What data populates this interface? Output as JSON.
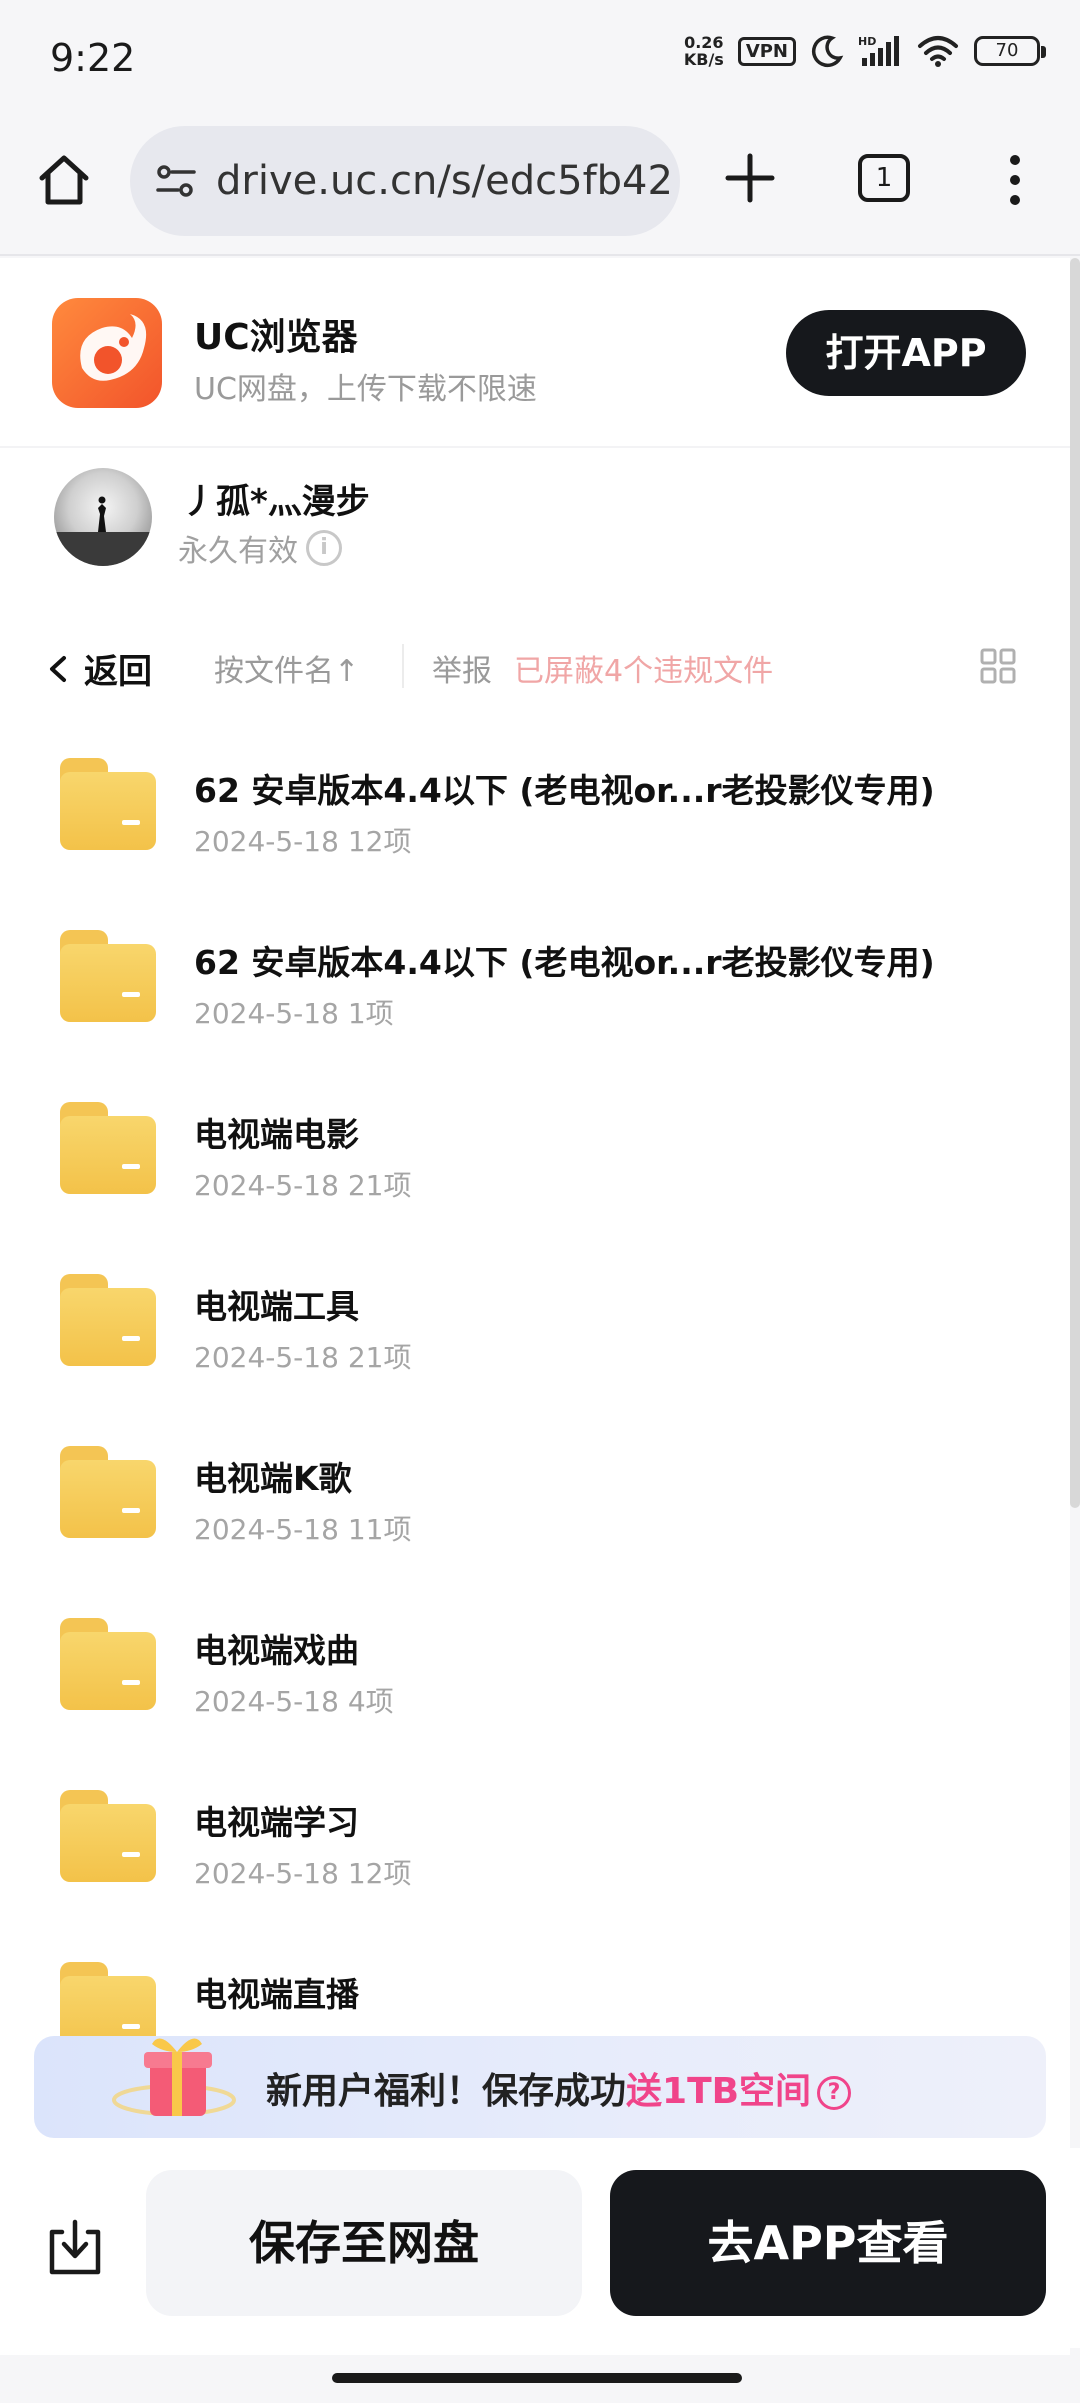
{
  "status_bar": {
    "time": "9:22",
    "net_speed_value": "0.26",
    "net_speed_unit": "KB/s",
    "vpn": "VPN",
    "battery": "70"
  },
  "browser": {
    "url": "drive.uc.cn/s/edc5fb42",
    "tab_count": "1"
  },
  "app_banner": {
    "name": "UC浏览器",
    "slogan": "UC网盘，上传下载不限速",
    "open_button": "打开APP"
  },
  "share": {
    "owner": "丿孤*灬漫步",
    "validity": "永久有效"
  },
  "toolbar": {
    "back": "返回",
    "sort": "按文件名",
    "sort_arrow": "↑",
    "report": "举报",
    "blocked": "已屏蔽4个违规文件"
  },
  "files": [
    {
      "title": "62 安卓版本4.4以下 (老电视or...r老投影仪专用)",
      "date": "2024-5-18",
      "count": "12项"
    },
    {
      "title": "62 安卓版本4.4以下 (老电视or...r老投影仪专用)",
      "date": "2024-5-18",
      "count": "1项"
    },
    {
      "title": "电视端电影",
      "date": "2024-5-18",
      "count": "21项"
    },
    {
      "title": "电视端工具",
      "date": "2024-5-18",
      "count": "21项"
    },
    {
      "title": "电视端K歌",
      "date": "2024-5-18",
      "count": "11项"
    },
    {
      "title": "电视端戏曲",
      "date": "2024-5-18",
      "count": "4项"
    },
    {
      "title": "电视端学习",
      "date": "2024-5-18",
      "count": "12项"
    },
    {
      "title": "电视端直播",
      "date": "",
      "count": ""
    }
  ],
  "promo": {
    "text": "新用户福利！保存成功",
    "highlight": "送1TB空间"
  },
  "bottom": {
    "save": "保存至网盘",
    "go_app": "去APP查看"
  },
  "colors": {
    "accent_pink": "#f0448a",
    "blocked_text": "#f0a6a6",
    "folder_yellow": "#f3c249",
    "dark_button": "#16181c"
  }
}
